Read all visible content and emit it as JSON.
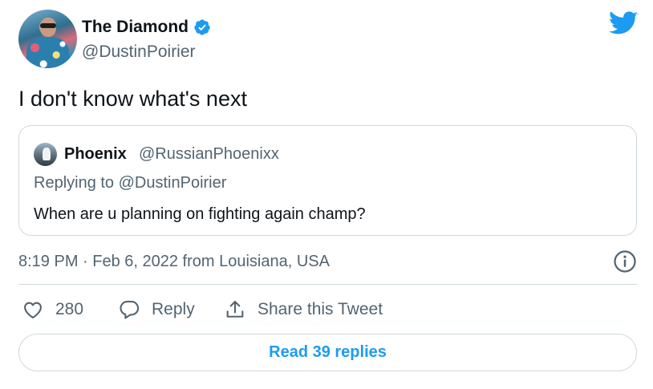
{
  "author": {
    "name": "The Diamond",
    "handle": "@DustinPoirier",
    "verified_icon": "verified-badge-icon",
    "avatar": "avatar"
  },
  "brand": {
    "icon": "twitter-bird-icon",
    "color": "#1d9bf0"
  },
  "tweet": {
    "text": "I don't know what's next"
  },
  "quoted": {
    "name": "Phoenix",
    "handle": "@RussianPhoenixx",
    "replying_prefix": "Replying to ",
    "replying_to": "@DustinPoirier",
    "text": "When are u planning on fighting again champ?"
  },
  "meta": {
    "timestamp": "8:19 PM · Feb 6, 2022 from Louisiana, USA",
    "info_icon": "info-icon"
  },
  "actions": {
    "like_count": "280",
    "reply_label": "Reply",
    "share_label": "Share this Tweet"
  },
  "read_replies_label": "Read 39 replies",
  "colors": {
    "text": "#0f1419",
    "secondary": "#536471",
    "border": "#cfd9de",
    "accent": "#1d9bf0"
  }
}
